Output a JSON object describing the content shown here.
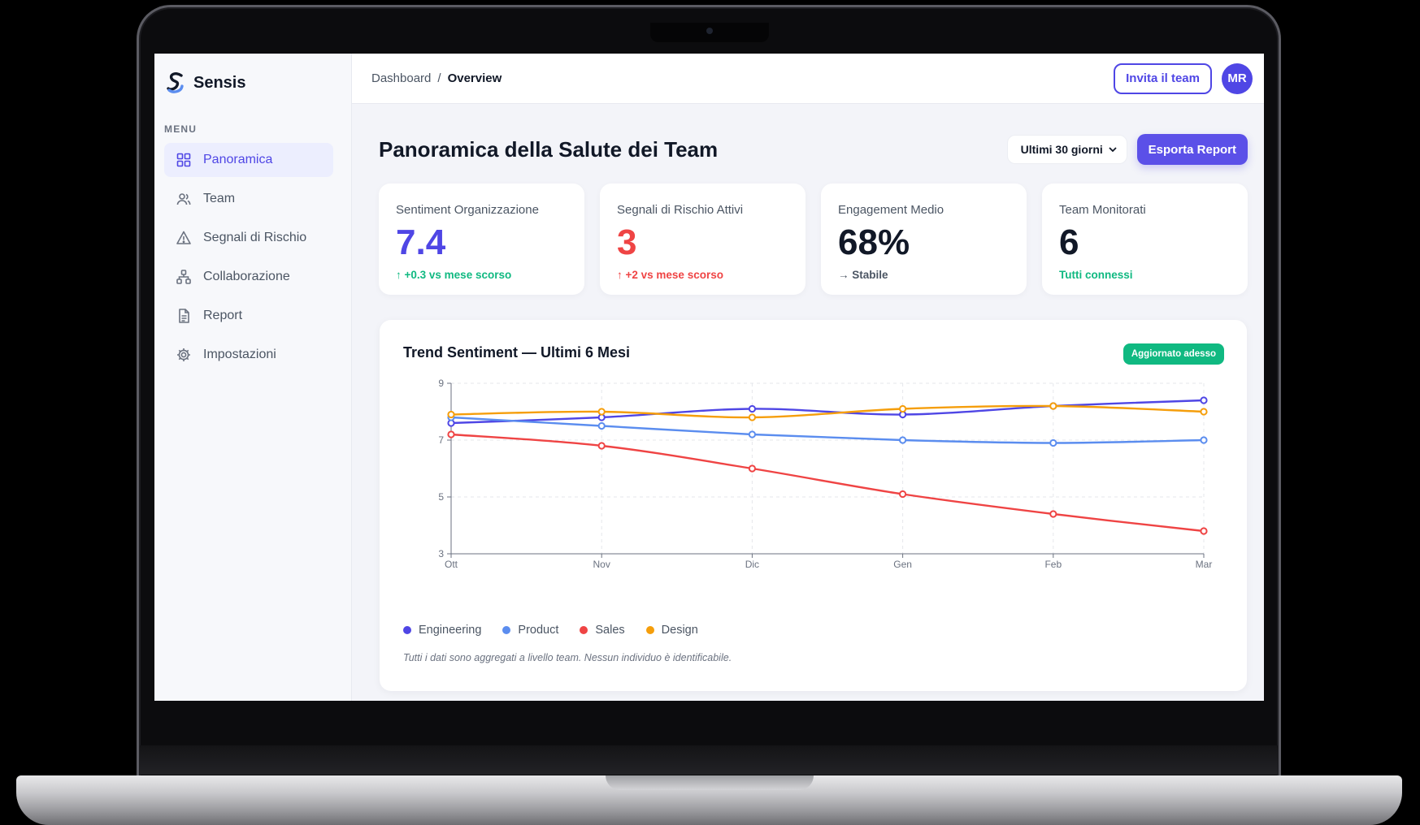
{
  "brand": {
    "name": "Sensis"
  },
  "sidebar": {
    "menu_label": "MENU",
    "items": [
      {
        "label": "Panoramica",
        "icon": "grid-icon",
        "active": true
      },
      {
        "label": "Team",
        "icon": "users-icon"
      },
      {
        "label": "Segnali di Rischio",
        "icon": "alert-triangle-icon"
      },
      {
        "label": "Collaborazione",
        "icon": "network-icon"
      },
      {
        "label": "Report",
        "icon": "document-icon"
      },
      {
        "label": "Impostazioni",
        "icon": "gear-icon"
      }
    ]
  },
  "topbar": {
    "breadcrumb": [
      "Dashboard",
      "Overview"
    ],
    "separator": "/",
    "invite_label": "Invita il team",
    "avatar_initials": "MR"
  },
  "header": {
    "title": "Panoramica della Salute dei Team",
    "range_value": "Ultimi 30 giorni",
    "export_label": "Esporta Report"
  },
  "kpis": [
    {
      "label": "Sentiment Organizzazione",
      "value": "7.4",
      "delta": "↑ +0.3 vs mese scorso",
      "value_color": "#4f46e5",
      "delta_color": "#10b981"
    },
    {
      "label": "Segnali di Rischio Attivi",
      "value": "3",
      "delta": "↑ +2 vs mese scorso",
      "value_color": "#ef4444",
      "delta_color": "#ef4444"
    },
    {
      "label": "Engagement Medio",
      "value": "68%",
      "delta": "→ Stabile",
      "value_color": "#111827",
      "delta_color": "#4b5563"
    },
    {
      "label": "Team Monitorati",
      "value": "6",
      "delta": "Tutti connessi",
      "value_color": "#111827",
      "delta_color": "#10b981"
    }
  ],
  "chart_card": {
    "title": "Trend Sentiment — Ultimi 6 Mesi",
    "badge": "Aggiornato adesso",
    "footnote": "Tutti i dati sono aggregati a livello team. Nessun individuo è identificabile."
  },
  "chart_data": {
    "type": "line",
    "x": [
      "Ott",
      "Nov",
      "Dic",
      "Gen",
      "Feb",
      "Mar"
    ],
    "ylim": [
      3,
      9
    ],
    "yticks": [
      3,
      5,
      7,
      9
    ],
    "grid": true,
    "legend": "bottom-left",
    "series": [
      {
        "name": "Engineering",
        "color": "#4f46e5",
        "values": [
          7.6,
          7.8,
          8.1,
          7.9,
          8.2,
          8.4
        ]
      },
      {
        "name": "Product",
        "color": "#5b8def",
        "values": [
          7.8,
          7.5,
          7.2,
          7.0,
          6.9,
          7.0
        ]
      },
      {
        "name": "Sales",
        "color": "#ef4444",
        "values": [
          7.2,
          6.8,
          6.0,
          5.1,
          4.4,
          3.8
        ]
      },
      {
        "name": "Design",
        "color": "#f59e0b",
        "values": [
          7.9,
          8.0,
          7.8,
          8.1,
          8.2,
          8.0
        ]
      }
    ]
  },
  "colors": {
    "accent": "#4f46e5",
    "success": "#10b981",
    "danger": "#ef4444"
  }
}
